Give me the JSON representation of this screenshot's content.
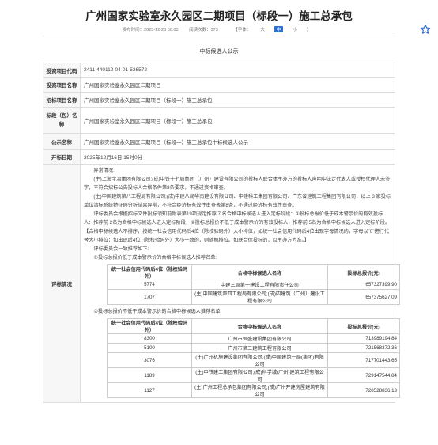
{
  "header": {
    "title": "广州国家实验室永久园区二期项目（标段一）施工总承包",
    "publish_time": "发布时间：2025-12-23 00:00",
    "views": "阅读次数：373",
    "font_label": "【字体：",
    "font_sizes": [
      "大",
      "中",
      "小"
    ],
    "font_close": "】",
    "active_font": 1
  },
  "subtitle": "中标候选人公示",
  "info_rows": [
    {
      "label": "投资项目代码",
      "value": "2411-440112-04-01-536572"
    },
    {
      "label": "投资项目名称",
      "value": "广州国家实验室永久园区二期项目"
    },
    {
      "label": "招标项目名称",
      "value": "广州国家实验室永久园区二期项目（标段一）施工总承包"
    },
    {
      "label": "标段（包）名称",
      "value": "广州国家实验室永久园区二期项目（标段一）施工总承包"
    },
    {
      "label": "公示名称",
      "value": "广州国家实验室永久园区二期项目（标段一）施工总承包中标候选人公示"
    },
    {
      "label": "开标日期",
      "value": "2025年12月16日 15时0分"
    }
  ],
  "evaluation": {
    "label": "评标情况",
    "paragraphs": [
      "异常情况:",
      "(主)上海宝冶集团有限公司;(成)中铁十七局集团（广州）建设有限公司的投标人联合体主办方的投标人声明中法定代表人或授权代理人未签字，不符合招标公告投标人合格条件第8条要求，不通过资格审查。",
      "(主)中国建筑第八工程局有限公司;(成)中建八局华南建设有限公司、中建科工集团有限公司、广东省建筑工程集团有限公司，以上 3 家投标单位清标系统特征码分析结果异常，不符合经济标有效性审查表第8条，不通过经济标有效性审查。",
      "评标委员会根据招标文件投标须知前附表第19项规定推荐 7 名合格中标候选人进入定标阶段：①投标总报价低于成本警示价的有效投标人：推荐前 2名为合格中标候选人进入定标阶段；②投标总报价不低于成本警示价的有效投标人，推荐前 5名为合格中标候选人进入定标阶段。【合格中标候选人不排序，按统一社会信用代码后4位（除校验码外）大小排位，如统一社会信用代码后4位出现字母情况的，字母以\"0\"进行代替大小排位；如出现后4位（除校验码外）大小一致的，则随机排位。如联合体投标的，以主办方为准。】",
      "评标委员会一致推荐如下:",
      "①投标总报价低于成本警示价的合格中标候选人推荐名单:"
    ],
    "table_headers": [
      "统一社会信用代码后4位（除校验码外）",
      "合格中标候选人名称",
      "投标总报价(元)"
    ],
    "table1": [
      {
        "code": "5774",
        "name": "中建三局第一建设工程有限责任公司",
        "price": "657327399.90"
      },
      {
        "code": "1707",
        "name": "(主)中国建筑第四工程局有限公司;(成)四建筑（广州）建设工程有限公司",
        "price": "657375627.09"
      }
    ],
    "para2": "②投标总报价不低于成本警示价的合格中标候选人推荐名单:",
    "table2": [
      {
        "code": "8300",
        "name": "广州市恒盛建设集团有限公司",
        "price": "713989194.84"
      },
      {
        "code": "5100",
        "name": "广州市第二建筑工程有限公司",
        "price": "721568372.36"
      },
      {
        "code": "3076",
        "name": "(主)广州机施建设集团有限公司;(成)中国建筑一局(集团)有限公司",
        "price": "717701443.65"
      },
      {
        "code": "1189",
        "name": "(主)中铁建工集团有限公司;(成)科学城(广州)建筑工程有限公司",
        "price": "729147544.84"
      },
      {
        "code": "1127",
        "name": "(主)广州工程总承包集团有限公司;(成)广州开建房屋建筑有限公司",
        "price": "728528836.13"
      }
    ]
  },
  "colors": {
    "accent": "#2e6fd2"
  }
}
